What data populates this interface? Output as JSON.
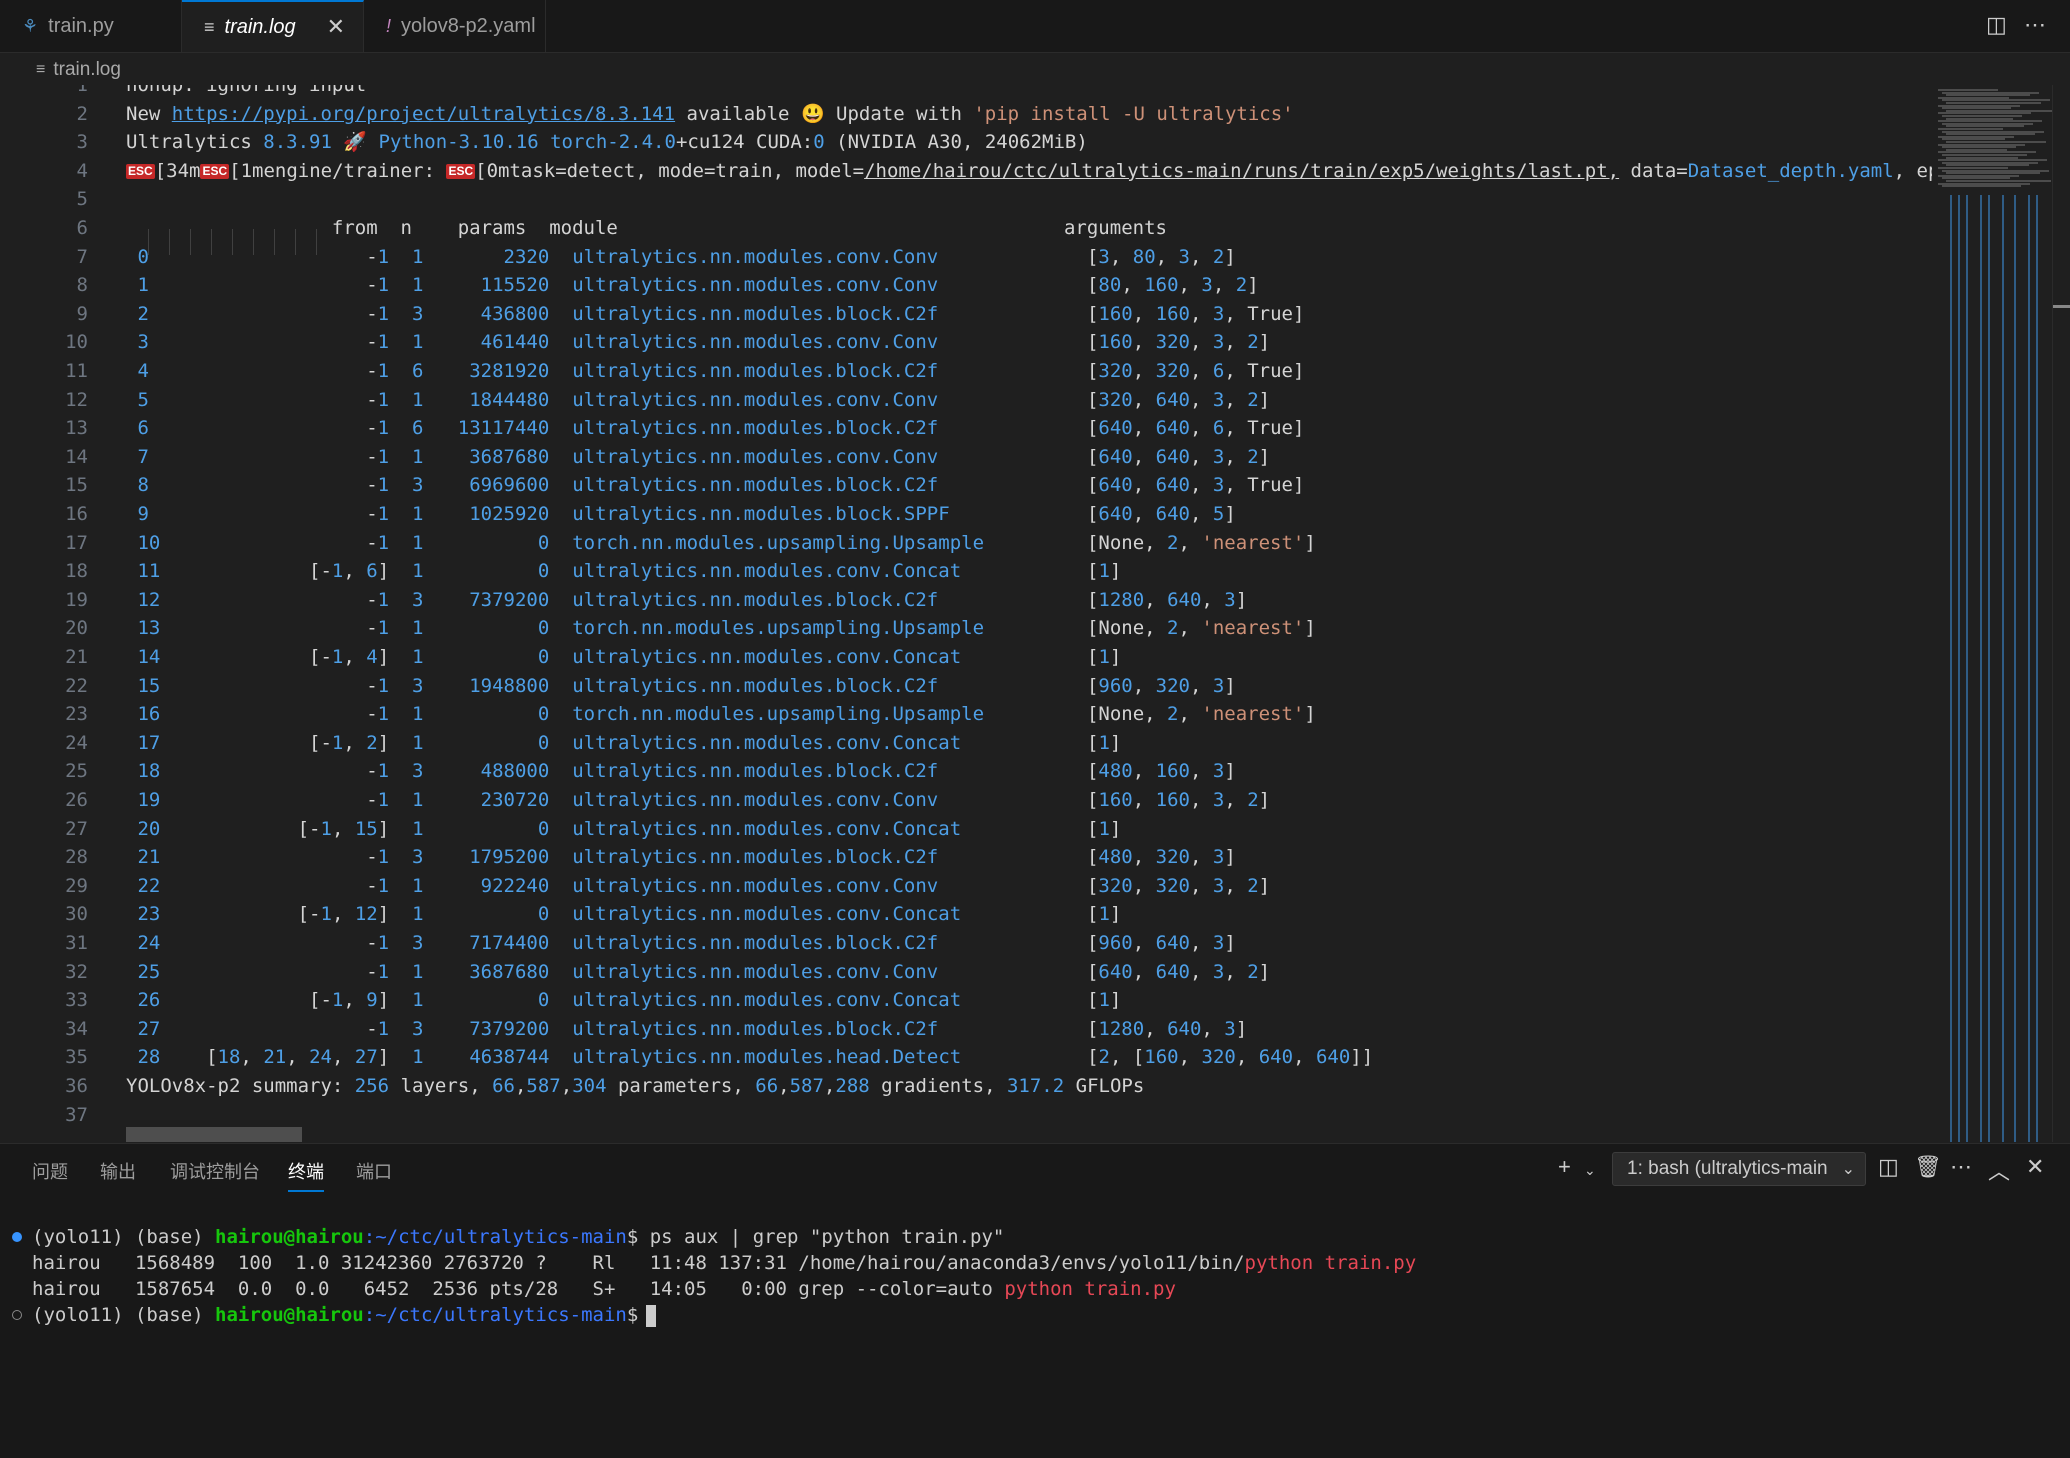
{
  "tabs": [
    {
      "label": "train.py",
      "icon": "python-icon"
    },
    {
      "label": "train.log",
      "icon": "log-file-icon",
      "active": true
    },
    {
      "label": "yolov8-p2.yaml",
      "icon": "yaml-icon"
    }
  ],
  "breadcrumb": "train.log",
  "header": {
    "l1": "nohup: ignoring input",
    "l2": {
      "a": "New ",
      "url": "https://pypi.org/project/ultralytics/8.3.141",
      "b": " available ",
      "emoji": "😃",
      "c": " Update with ",
      "cmd": "'pip install -U ultralytics'"
    },
    "l3": {
      "a": "Ultralytics ",
      "ver": "8.3.91",
      "rocket": "🚀",
      "py": "Python-3.10.16",
      "torch": "torch-2.4.0",
      "c": "+cu124 CUDA:",
      "cuda": "0",
      "d": " (NVIDIA A30, 24062MiB)"
    },
    "l4": {
      "esc": "ESC",
      "a": "[34m",
      "b": "[1mengine/trainer: ",
      "c": "[0mtask=detect, mode=train, model=",
      "path": "/home/hairou/ctc/ultralytics-main/runs/train/exp5/weights/last.pt,",
      "d": " data=",
      "data": "Dataset_depth.yaml",
      "e": ", ep"
    }
  },
  "table_header": {
    "from": "from",
    "n": "n",
    "params": "params",
    "module": "module",
    "arguments": "arguments"
  },
  "layers": [
    {
      "idx": "0",
      "from": "-1",
      "n": "1",
      "params": "2320",
      "module": "ultralytics.nn.modules.conv.Conv",
      "args": "[3, 80, 3, 2]"
    },
    {
      "idx": "1",
      "from": "-1",
      "n": "1",
      "params": "115520",
      "module": "ultralytics.nn.modules.conv.Conv",
      "args": "[80, 160, 3, 2]"
    },
    {
      "idx": "2",
      "from": "-1",
      "n": "3",
      "params": "436800",
      "module": "ultralytics.nn.modules.block.C2f",
      "args": "[160, 160, 3, True]"
    },
    {
      "idx": "3",
      "from": "-1",
      "n": "1",
      "params": "461440",
      "module": "ultralytics.nn.modules.conv.Conv",
      "args": "[160, 320, 3, 2]"
    },
    {
      "idx": "4",
      "from": "-1",
      "n": "6",
      "params": "3281920",
      "module": "ultralytics.nn.modules.block.C2f",
      "args": "[320, 320, 6, True]"
    },
    {
      "idx": "5",
      "from": "-1",
      "n": "1",
      "params": "1844480",
      "module": "ultralytics.nn.modules.conv.Conv",
      "args": "[320, 640, 3, 2]"
    },
    {
      "idx": "6",
      "from": "-1",
      "n": "6",
      "params": "13117440",
      "module": "ultralytics.nn.modules.block.C2f",
      "args": "[640, 640, 6, True]"
    },
    {
      "idx": "7",
      "from": "-1",
      "n": "1",
      "params": "3687680",
      "module": "ultralytics.nn.modules.conv.Conv",
      "args": "[640, 640, 3, 2]"
    },
    {
      "idx": "8",
      "from": "-1",
      "n": "3",
      "params": "6969600",
      "module": "ultralytics.nn.modules.block.C2f",
      "args": "[640, 640, 3, True]"
    },
    {
      "idx": "9",
      "from": "-1",
      "n": "1",
      "params": "1025920",
      "module": "ultralytics.nn.modules.block.SPPF",
      "args": "[640, 640, 5]"
    },
    {
      "idx": "10",
      "from": "-1",
      "n": "1",
      "params": "0",
      "module": "torch.nn.modules.upsampling.Upsample",
      "args": "[None, 2, 'nearest']"
    },
    {
      "idx": "11",
      "from": "[-1, 6]",
      "n": "1",
      "params": "0",
      "module": "ultralytics.nn.modules.conv.Concat",
      "args": "[1]"
    },
    {
      "idx": "12",
      "from": "-1",
      "n": "3",
      "params": "7379200",
      "module": "ultralytics.nn.modules.block.C2f",
      "args": "[1280, 640, 3]"
    },
    {
      "idx": "13",
      "from": "-1",
      "n": "1",
      "params": "0",
      "module": "torch.nn.modules.upsampling.Upsample",
      "args": "[None, 2, 'nearest']"
    },
    {
      "idx": "14",
      "from": "[-1, 4]",
      "n": "1",
      "params": "0",
      "module": "ultralytics.nn.modules.conv.Concat",
      "args": "[1]"
    },
    {
      "idx": "15",
      "from": "-1",
      "n": "3",
      "params": "1948800",
      "module": "ultralytics.nn.modules.block.C2f",
      "args": "[960, 320, 3]"
    },
    {
      "idx": "16",
      "from": "-1",
      "n": "1",
      "params": "0",
      "module": "torch.nn.modules.upsampling.Upsample",
      "args": "[None, 2, 'nearest']"
    },
    {
      "idx": "17",
      "from": "[-1, 2]",
      "n": "1",
      "params": "0",
      "module": "ultralytics.nn.modules.conv.Concat",
      "args": "[1]"
    },
    {
      "idx": "18",
      "from": "-1",
      "n": "3",
      "params": "488000",
      "module": "ultralytics.nn.modules.block.C2f",
      "args": "[480, 160, 3]"
    },
    {
      "idx": "19",
      "from": "-1",
      "n": "1",
      "params": "230720",
      "module": "ultralytics.nn.modules.conv.Conv",
      "args": "[160, 160, 3, 2]"
    },
    {
      "idx": "20",
      "from": "[-1, 15]",
      "n": "1",
      "params": "0",
      "module": "ultralytics.nn.modules.conv.Concat",
      "args": "[1]"
    },
    {
      "idx": "21",
      "from": "-1",
      "n": "3",
      "params": "1795200",
      "module": "ultralytics.nn.modules.block.C2f",
      "args": "[480, 320, 3]"
    },
    {
      "idx": "22",
      "from": "-1",
      "n": "1",
      "params": "922240",
      "module": "ultralytics.nn.modules.conv.Conv",
      "args": "[320, 320, 3, 2]"
    },
    {
      "idx": "23",
      "from": "[-1, 12]",
      "n": "1",
      "params": "0",
      "module": "ultralytics.nn.modules.conv.Concat",
      "args": "[1]"
    },
    {
      "idx": "24",
      "from": "-1",
      "n": "3",
      "params": "7174400",
      "module": "ultralytics.nn.modules.block.C2f",
      "args": "[960, 640, 3]"
    },
    {
      "idx": "25",
      "from": "-1",
      "n": "1",
      "params": "3687680",
      "module": "ultralytics.nn.modules.conv.Conv",
      "args": "[640, 640, 3, 2]"
    },
    {
      "idx": "26",
      "from": "[-1, 9]",
      "n": "1",
      "params": "0",
      "module": "ultralytics.nn.modules.conv.Concat",
      "args": "[1]"
    },
    {
      "idx": "27",
      "from": "-1",
      "n": "3",
      "params": "7379200",
      "module": "ultralytics.nn.modules.block.C2f",
      "args": "[1280, 640, 3]"
    },
    {
      "idx": "28",
      "from": "[18, 21, 24, 27]",
      "n": "1",
      "params": "4638744",
      "module": "ultralytics.nn.modules.head.Detect",
      "args": "[2, [160, 320, 640, 640]]"
    }
  ],
  "summary": "YOLOv8x-p2 summary: 256 layers, 66,587,304 parameters, 66,587,288 gradients, 317.2 GFLOPs",
  "line_count": 37,
  "panel": {
    "tabs": [
      "问题",
      "输出",
      "调试控制台",
      "终端",
      "端口"
    ],
    "active_tab": "终端",
    "terminal_select": "1: bash (ultralytics-main"
  },
  "terminal": {
    "env": "(yolo11) (base) ",
    "user": "hairou@hairou",
    "path": ":~/ctc/ultralytics-main",
    "cmd": "$ ps aux | grep \"python train.py\"",
    "row1": {
      "a": "hairou   1568489  100  1.0 31242360 2763720 ?    Rl   11:48 137:31 /home/hairou/anaconda3/envs/yolo11/bin/",
      "m1": "python",
      "b": " ",
      "m2": "train.py"
    },
    "row2": {
      "a": "hairou   1587654  0.0  0.0   6452  2536 pts/28   S+   14:05   0:00 grep --color=auto ",
      "m1": "python",
      "b": " ",
      "m2": "train.py"
    },
    "prompt_end": "$"
  },
  "colors": {
    "accent": "#0078d4",
    "number": "#4e9fe6",
    "string": "#ce9178",
    "prompt_green": "#16c60c",
    "path_blue": "#3b78ff",
    "match_red": "#e74856"
  }
}
